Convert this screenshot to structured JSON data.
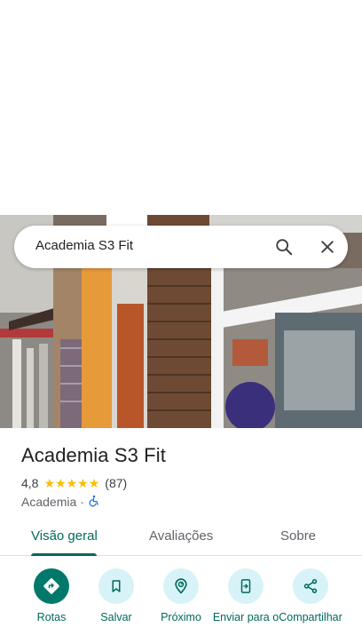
{
  "search": {
    "query": "Academia S3 Fit"
  },
  "place": {
    "name": "Academia S3 Fit",
    "rating": "4,8",
    "stars": [
      "★",
      "★",
      "★",
      "★",
      "★"
    ],
    "reviews": "(87)",
    "category": "Academia",
    "separator": "·"
  },
  "tabs": [
    {
      "label": "Visão geral",
      "active": true
    },
    {
      "label": "Avaliações"
    },
    {
      "label": "Sobre"
    }
  ],
  "actions": [
    {
      "label": "Rotas",
      "icon": "directions-icon"
    },
    {
      "label": "Salvar",
      "icon": "bookmark-icon"
    },
    {
      "label": "Próximo",
      "icon": "nearby-icon"
    },
    {
      "label": "Enviar para o",
      "icon": "send-to-phone-icon"
    },
    {
      "label": "Compartilhar",
      "icon": "share-icon"
    }
  ],
  "colors": {
    "accent": "#00695c",
    "primary_button": "#00796b",
    "action_bg": "#d7f3f7",
    "star": "#fbbc04"
  }
}
